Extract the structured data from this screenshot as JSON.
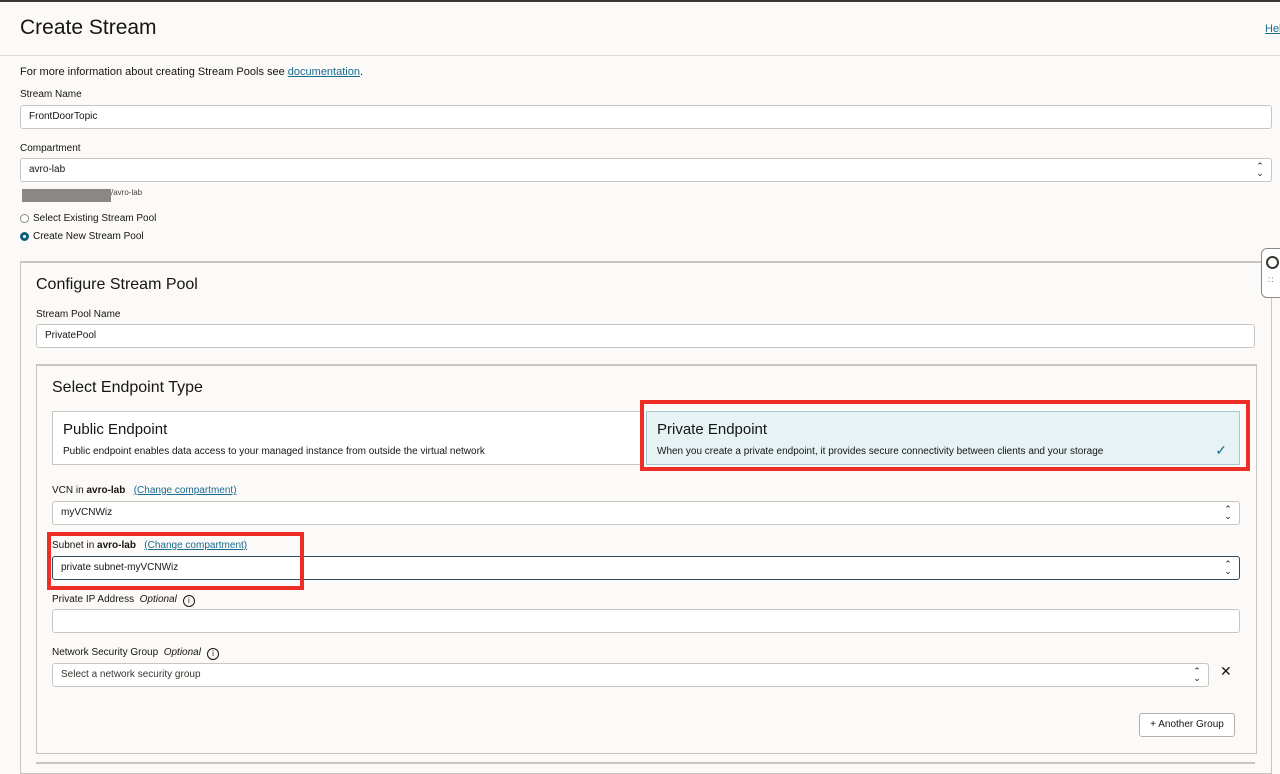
{
  "header": {
    "title": "Create Stream",
    "help_link": "Help"
  },
  "info": {
    "prefix": "For more information about creating Stream Pools see ",
    "link": "documentation",
    "suffix": "."
  },
  "stream_name": {
    "label": "Stream Name",
    "value": "FrontDoorTopic"
  },
  "compartment": {
    "label": "Compartment",
    "value": "avro-lab",
    "path_tail": "/avro-lab"
  },
  "pool_choice": {
    "existing_label": "Select Existing Stream Pool",
    "new_label": "Create New Stream Pool",
    "selected": "new"
  },
  "configure_pool": {
    "title": "Configure Stream Pool",
    "pool_name_label": "Stream Pool Name",
    "pool_name_value": "PrivatePool"
  },
  "endpoint": {
    "title": "Select Endpoint Type",
    "public": {
      "title": "Public Endpoint",
      "desc": "Public endpoint enables data access to your managed instance from outside the virtual network"
    },
    "private": {
      "title": "Private Endpoint",
      "desc": "When you create a private endpoint, it provides secure connectivity between clients and your storage",
      "selected": true
    }
  },
  "vcn": {
    "label_prefix": "VCN in ",
    "compartment": "avro-lab",
    "change_link": "(Change compartment)",
    "value": "myVCNWiz"
  },
  "subnet": {
    "label_prefix": "Subnet in ",
    "compartment": "avro-lab",
    "change_link": "(Change compartment)",
    "value": "private subnet-myVCNWiz"
  },
  "private_ip": {
    "label": "Private IP Address",
    "optional": "Optional",
    "value": ""
  },
  "nsg": {
    "label": "Network Security Group",
    "optional": "Optional",
    "placeholder": "Select a network security group"
  },
  "buttons": {
    "another_group": "+ Another Group",
    "remove": "✕"
  },
  "colors": {
    "accent": "#1a6b8f",
    "highlight": "#ee2d24",
    "selected_card": "#e7f2f4"
  }
}
